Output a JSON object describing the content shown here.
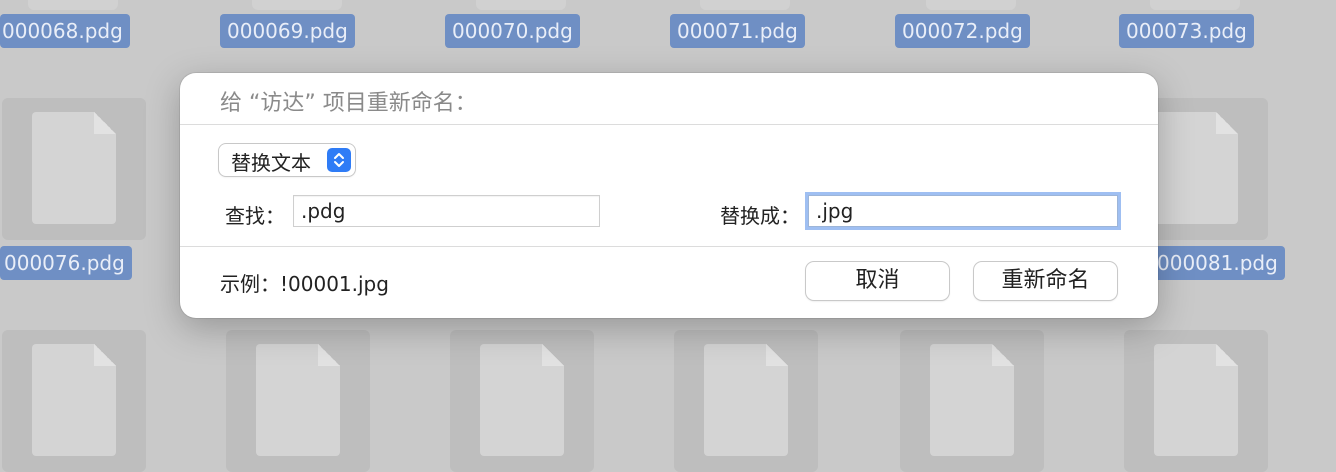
{
  "background_files": {
    "labels_top": [
      "000068.pdg",
      "000069.pdg",
      "000070.pdg",
      "000071.pdg",
      "000072.pdg",
      "000073.pdg"
    ],
    "labels_middle": [
      "000076.pdg",
      "000081.pdg"
    ]
  },
  "dialog": {
    "title": "给 “访达” 项目重新命名：",
    "mode_popup": {
      "selected": "替换文本"
    },
    "find": {
      "label": "查找：",
      "value": ".pdg"
    },
    "replace": {
      "label": "替换成：",
      "value": ".jpg"
    },
    "example": "示例：!00001.jpg",
    "cancel_label": "取消",
    "rename_label": "重新命名"
  },
  "colors": {
    "accent": "#2f7cf6",
    "selection_label": "#6f8fc4",
    "focus_ring": "#9fbff2"
  }
}
